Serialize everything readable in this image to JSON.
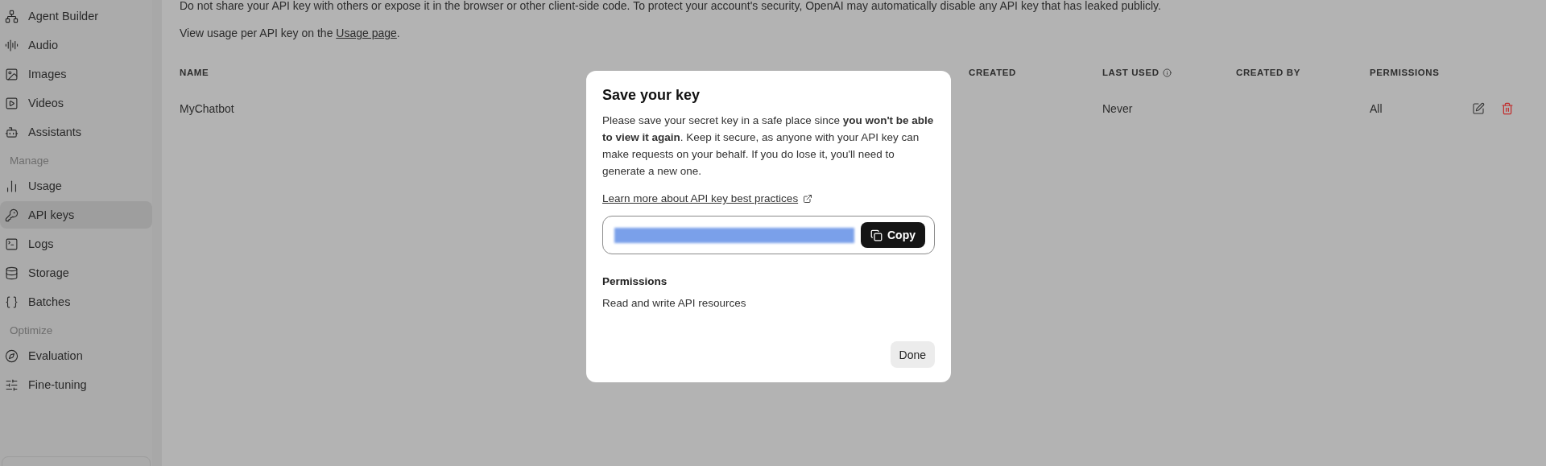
{
  "sidebar": {
    "items": [
      {
        "kind": "item",
        "label": "Agent Builder",
        "selected": false
      },
      {
        "kind": "item",
        "label": "Audio",
        "selected": false
      },
      {
        "kind": "item",
        "label": "Images",
        "selected": false
      },
      {
        "kind": "item",
        "label": "Videos",
        "selected": false
      },
      {
        "kind": "item",
        "label": "Assistants",
        "selected": false
      },
      {
        "kind": "heading",
        "label": "Manage"
      },
      {
        "kind": "item",
        "label": "Usage",
        "selected": false
      },
      {
        "kind": "item",
        "label": "API keys",
        "selected": true
      },
      {
        "kind": "item",
        "label": "Logs",
        "selected": false
      },
      {
        "kind": "item",
        "label": "Storage",
        "selected": false
      },
      {
        "kind": "item",
        "label": "Batches",
        "selected": false
      },
      {
        "kind": "heading",
        "label": "Optimize"
      },
      {
        "kind": "item",
        "label": "Evaluation",
        "selected": false
      },
      {
        "kind": "item",
        "label": "Fine-tuning",
        "selected": false
      }
    ]
  },
  "notice": "Do not share your API key with others or expose it in the browser or other client-side code. To protect your account's security, OpenAI may automatically disable any API key that has leaked publicly.",
  "usage_note": {
    "before": "View usage per API key on the ",
    "link": "Usage page",
    "after": "."
  },
  "table": {
    "columns": [
      {
        "label": "NAME",
        "info": false
      },
      {
        "label": "CREATED",
        "info": false
      },
      {
        "label": "LAST USED",
        "info": true
      },
      {
        "label": "CREATED BY",
        "info": false
      },
      {
        "label": "PERMISSIONS",
        "info": false
      }
    ],
    "rows": [
      {
        "name": "MyChatbot",
        "last_used": "Never",
        "permissions": "All"
      }
    ]
  },
  "dialog": {
    "title": "Save your key",
    "body": "Please save your secret key in a safe place since **you won't be able to view it again**. Keep it secure, as anyone with your API key can make requests on your behalf. If you do lose it, you'll need to generate a new one.",
    "link": "Learn more about API key best practices",
    "copy": "Copy",
    "permissions_title": "Permissions",
    "permissions_value": "Read and write API resources",
    "done": "Done"
  }
}
